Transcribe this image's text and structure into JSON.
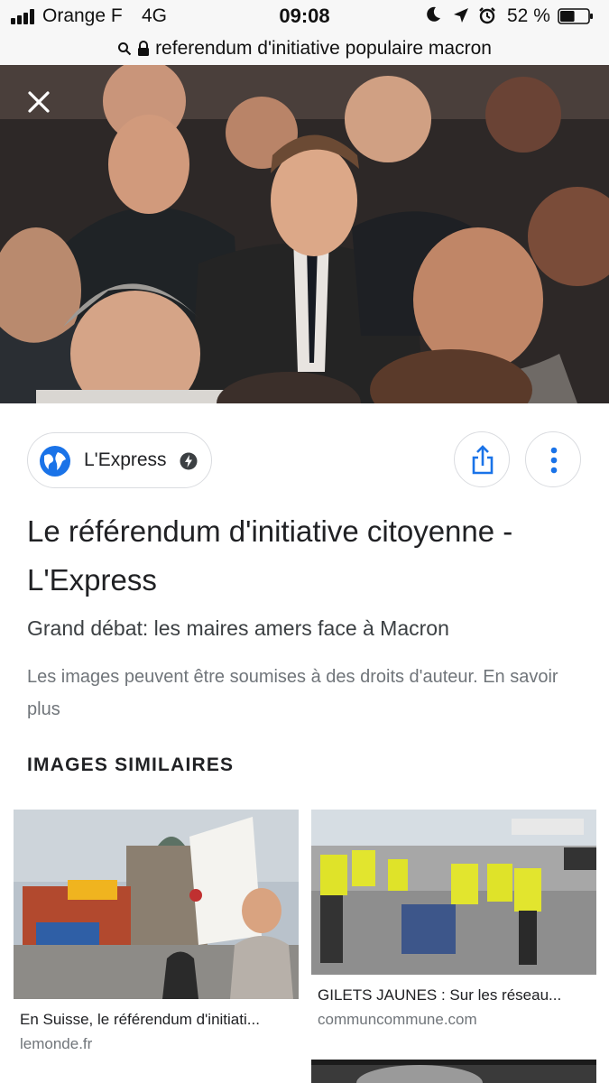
{
  "status_bar": {
    "carrier": "Orange F",
    "network": "4G",
    "time": "09:08",
    "battery_percent": "52 %",
    "battery_level": 0.52,
    "icons": [
      "signal-icon",
      "moon-icon",
      "location-arrow-icon",
      "alarm-icon",
      "battery-icon"
    ]
  },
  "address_bar": {
    "url": "referendum d'initiative populaire macron",
    "icons": [
      "search-icon",
      "lock-icon"
    ]
  },
  "hero_image": {
    "description_icon": "photo"
  },
  "result": {
    "source_name": "L'Express",
    "title": "Le référendum d'initiative citoyenne - L'Express",
    "subtitle": "Grand débat: les maires amers face à Macron",
    "copyright": "Les images peuvent être soumises à des droits d'auteur. En savoir plus",
    "icons": [
      "close-icon",
      "globe-icon",
      "amp-bolt-icon",
      "share-icon",
      "more-vert-icon"
    ]
  },
  "similar": {
    "heading": "IMAGES SIMILAIRES",
    "items": [
      {
        "caption": "En Suisse, le référendum d'initiati...",
        "source": "lemonde.fr"
      },
      {
        "caption": "GILETS JAUNES : Sur les réseau...",
        "source": "communcommune.com"
      }
    ]
  },
  "colors": {
    "accent_blue": "#1a73e8",
    "text_primary": "#202124",
    "text_secondary": "#70757a",
    "border": "#dadce0"
  }
}
